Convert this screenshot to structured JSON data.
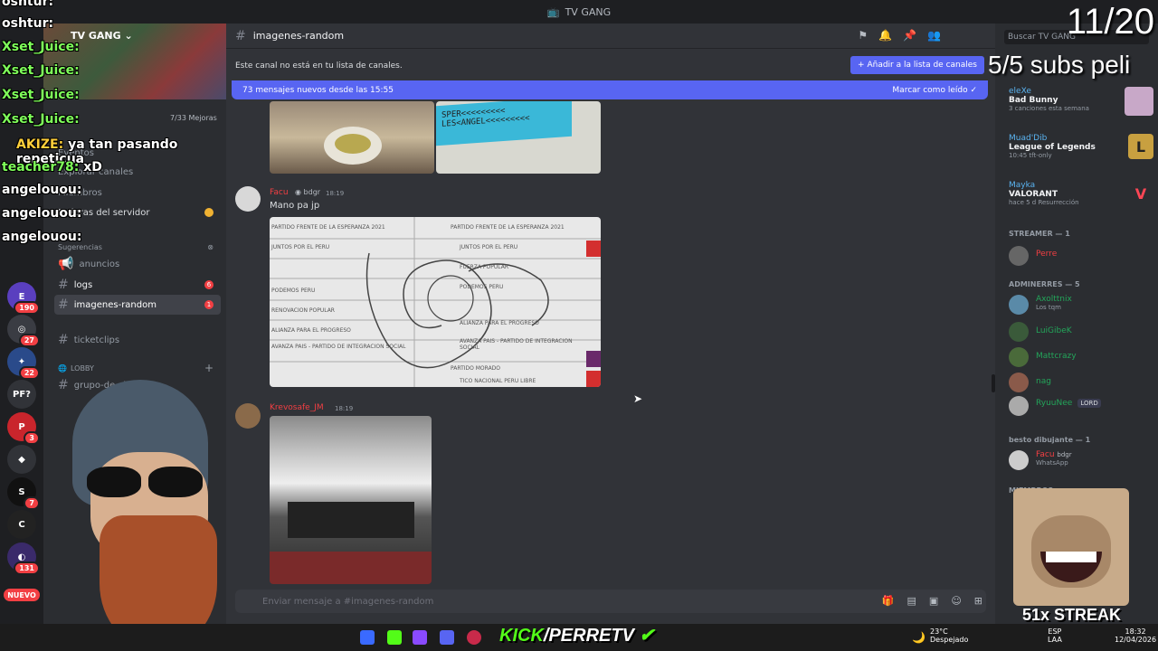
{
  "window": {
    "title": "TV GANG"
  },
  "server": {
    "name": "TV GANG"
  },
  "sidebar": {
    "items": [
      {
        "label": "Eventos"
      },
      {
        "label": "Explorar canales"
      },
      {
        "label": "Miembros"
      },
      {
        "label": "Mejoras del servidor"
      },
      {
        "label": "Sugerencias"
      }
    ],
    "boost": "7/33 Mejoras",
    "channels": [
      {
        "label": "anuncios"
      },
      {
        "label": "logs",
        "count": "6"
      },
      {
        "label": "imagenes-random",
        "count": "1"
      },
      {
        "label": "ticketclips"
      }
    ],
    "category": "LOBBY",
    "lobby_first": "grupo-de-cl"
  },
  "guild_badges": [
    "190",
    "27",
    "22",
    "3",
    "7",
    "131"
  ],
  "guild_labels": [
    "PF?",
    "NUEVO"
  ],
  "chat": {
    "channel": "imagenes-random",
    "notice": "Este canal no está en tu lista de canales.",
    "add_button": "Añadir a la lista de canales",
    "new_messages": "73 mensajes nuevos desde las 15:55",
    "mark_read": "Marcar como leído",
    "input_placeholder": "Enviar mensaje a #imagenes-random",
    "image1_text": "SPER<<<<<<<<<\nLES<ANGEL<<<<<<<<<",
    "messages": [
      {
        "author": "Facu",
        "tag": "bdgr",
        "time": "18:19",
        "text": "Mano pa jp"
      },
      {
        "author": "Krevosafe_JM",
        "time": "18:19",
        "text": ""
      }
    ],
    "ballot_lines": [
      "PARTIDO FRENTE DE LA ESPERANZA 2021",
      "JUNTOS POR EL PERU",
      "FUERZA POPULAR",
      "PODEMOS PERU",
      "RENOVACION POPULAR",
      "ALIANZA PARA EL PROGRESO",
      "AVANZA PAIS - PARTIDO DE INTEGRACION SOCIAL",
      "PARTIDO MORADO"
    ],
    "ballot_right": [
      "PARTIDO FRENTE DE LA ESPERANZA 2021",
      "JUNTOS POR EL PERU",
      "FUERZA POPULAR",
      "PODEMOS PERU",
      "ALIANZA PARA EL PROGRESO",
      "AVANZA PAIS - PARTIDO DE INTEGRACION SOCIAL",
      "PARTIDO MORADO"
    ],
    "ballot_footer": "TICO NACIONAL PERU LIBRE"
  },
  "members": {
    "search": "Buscar TV GANG",
    "activities": [
      {
        "name": "eleXe",
        "game": "Bad Bunny",
        "sub": "3 canciones esta semana"
      },
      {
        "name": "Muad'Dib",
        "game": "League of Legends",
        "sub": "10:45  tft-only"
      },
      {
        "name": "Mayka",
        "game": "VALORANT",
        "sub": "hace 5 d  Resurrección"
      }
    ],
    "streamer_header": "STREAMER — 1",
    "streamer": "Perre",
    "admin_header": "ADMINERRES — 5",
    "admins": [
      {
        "name": "Axolttnix",
        "sub": "Los tqm"
      },
      {
        "name": "LuiGibeK",
        "sub": ""
      },
      {
        "name": "Mattcrazy",
        "sub": ""
      },
      {
        "name": "nag",
        "sub": ""
      },
      {
        "name": "RyuuNee",
        "sub": "",
        "tag": "LORD"
      }
    ],
    "artist_header": "besto dibujante — 1",
    "artist": {
      "name": "Facu",
      "tag": "bdgr",
      "sub": "WhatsApp"
    },
    "mem_header": "MIEMBROS"
  },
  "overlay": {
    "counter": "11/20",
    "subs": "5/5 subs peli",
    "chat": [
      {
        "user": "oshtur:",
        "msg": ""
      },
      {
        "user": "oshtur:",
        "msg": ""
      },
      {
        "user": "Xset_Juice:",
        "msg": ""
      },
      {
        "user": "Xset_Juice:",
        "msg": ""
      },
      {
        "user": "Xset_Juice:",
        "msg": ""
      },
      {
        "user": "Xset_Juice:",
        "msg": ""
      },
      {
        "user": "AKIZE:",
        "msg": "ya tan pasando repeticua"
      },
      {
        "user": "teacher78:",
        "msg": "xD"
      },
      {
        "user": "angelouou:",
        "msg": ""
      },
      {
        "user": "angelouou:",
        "msg": ""
      },
      {
        "user": "angelouou:",
        "msg": ""
      }
    ],
    "kick_brand": "KICK",
    "kick_handle": "/PERRETV",
    "streak": "51x STREAK"
  },
  "taskbar": {
    "weather_temp": "23°C",
    "weather_desc": "Despejado",
    "lang_top": "ESP",
    "lang_bottom": "LAA",
    "time": "18:32",
    "date": "12/04/2026"
  },
  "colors": {
    "blurple": "#5865f2",
    "red": "#f23f43",
    "green": "#23a55a",
    "kick": "#53fc18"
  }
}
